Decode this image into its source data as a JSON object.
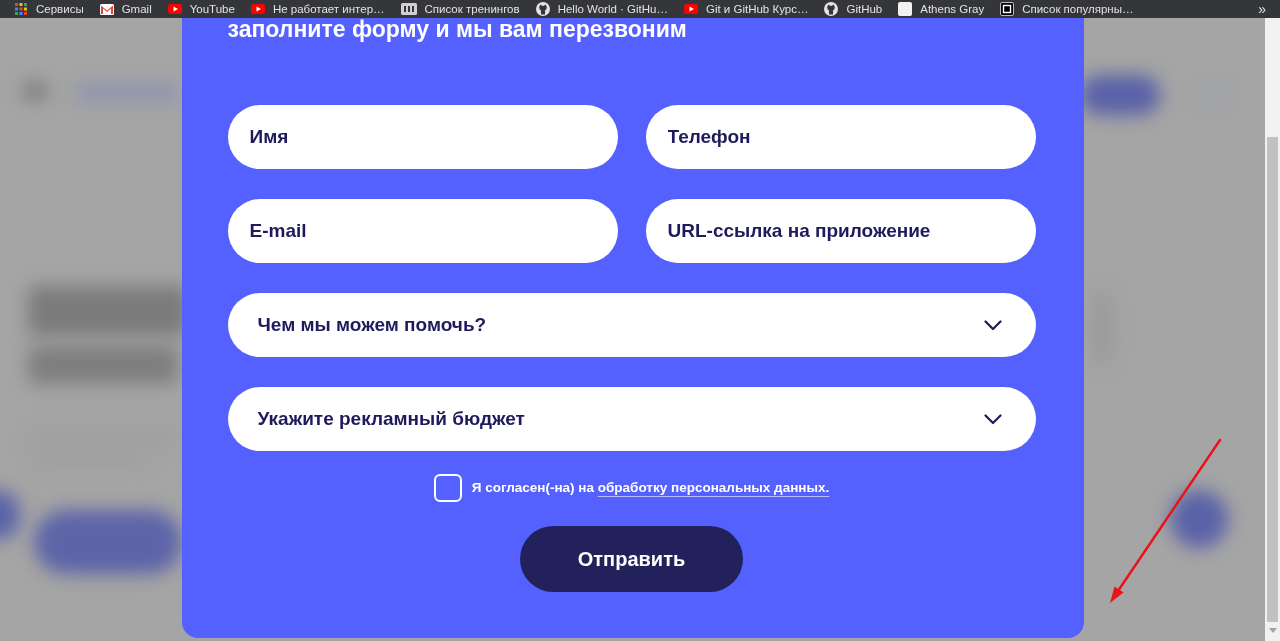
{
  "bookmarks_bar": {
    "items": [
      {
        "kind": "apps",
        "label": "Сервисы"
      },
      {
        "kind": "mail",
        "label": "Gmail"
      },
      {
        "kind": "video",
        "label": "YouTube"
      },
      {
        "kind": "video",
        "label": "Не работает интер…"
      },
      {
        "kind": "thumbnail",
        "label": "Список тренингов"
      },
      {
        "kind": "github",
        "label": "Hello World · GitHu…"
      },
      {
        "kind": "video",
        "label": "Git и GitHub Курс…"
      },
      {
        "kind": "github",
        "label": "GitHub"
      },
      {
        "kind": "page",
        "label": "Athens Gray"
      },
      {
        "kind": "tile",
        "label": "Список популярны…"
      }
    ],
    "overflow": "»"
  },
  "modal": {
    "heading": "заполните форму и мы вам перезвоним",
    "fields": [
      {
        "placeholder": "Имя"
      },
      {
        "placeholder": "Телефон"
      },
      {
        "placeholder": "E-mail"
      },
      {
        "placeholder": "URL-ссылка на приложение"
      }
    ],
    "dropdowns": [
      {
        "placeholder": "Чем мы можем помочь?"
      },
      {
        "placeholder": "Укажите рекламный бюджет"
      }
    ],
    "consent": {
      "checked": false,
      "text": "Я согласен(-на) на",
      "link": "обработку персональных данных."
    },
    "submit": "Отправить"
  }
}
